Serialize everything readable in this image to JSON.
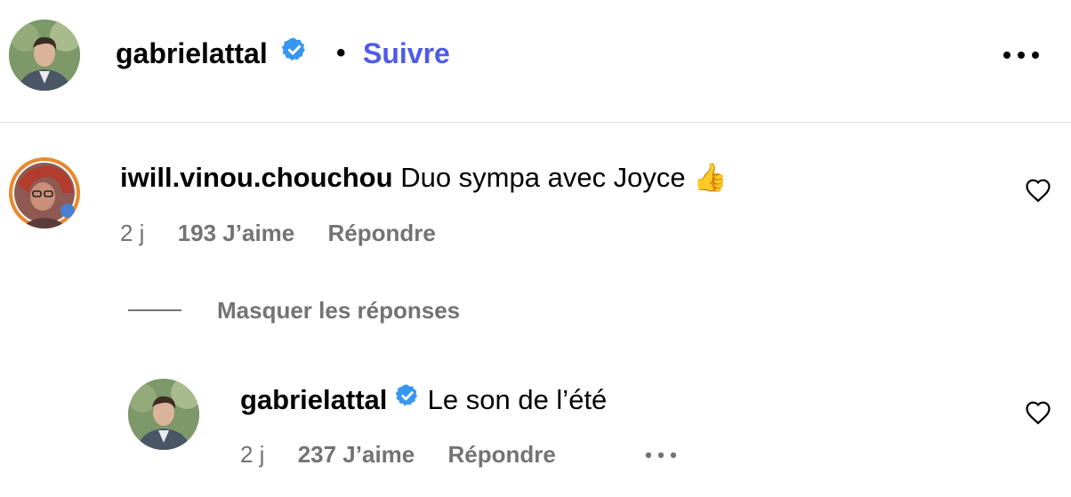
{
  "post_header": {
    "username": "gabrielattal",
    "verified": true,
    "separator": "•",
    "follow_label": "Suivre",
    "accent_color": "#4f5ae8"
  },
  "comments": [
    {
      "username": "iwill.vinou.chouchou",
      "text": "Duo sympa avec Joyce",
      "emoji": "👍",
      "emoji_icon": "thumbs-up-icon",
      "time": "2 j",
      "likes": "193 J’aime",
      "reply_label": "Répondre",
      "hide_replies_label": "Masquer les réponses",
      "replies": [
        {
          "username": "gabrielattal",
          "verified": true,
          "text": "Le son de l’été",
          "time": "2 j",
          "likes": "237 J’aime",
          "reply_label": "Répondre"
        }
      ]
    }
  ],
  "icons": {
    "verified": "verified-badge-icon",
    "heart": "heart-outline-icon",
    "more": "more-options-icon"
  },
  "colors": {
    "verified_blue": "#3797f0",
    "secondary_text": "#737373",
    "divider": "#e3e3e3"
  }
}
